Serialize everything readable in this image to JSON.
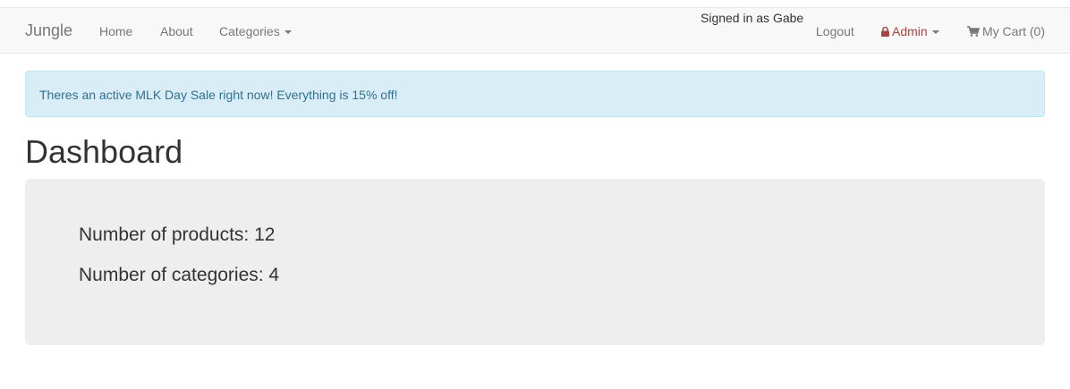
{
  "navbar": {
    "brand": "Jungle",
    "home": "Home",
    "about": "About",
    "categories": "Categories",
    "signed_in": "Signed in as Gabe",
    "logout": "Logout",
    "admin": "Admin",
    "cart": "My Cart (0)",
    "admin_icon": "lock-icon",
    "cart_icon": "shopping-cart-icon"
  },
  "alert": {
    "message": "Theres an active MLK Day Sale right now! Everything is 15% off!"
  },
  "page": {
    "title": "Dashboard"
  },
  "stats": {
    "products": "Number of products: 12",
    "categories": "Number of categories: 4"
  },
  "colors": {
    "navbar_bg": "#f8f8f8",
    "admin_text": "#a94442",
    "alert_bg": "#d9edf7",
    "alert_text": "#31708f",
    "jumbotron_bg": "#eeeeee"
  }
}
